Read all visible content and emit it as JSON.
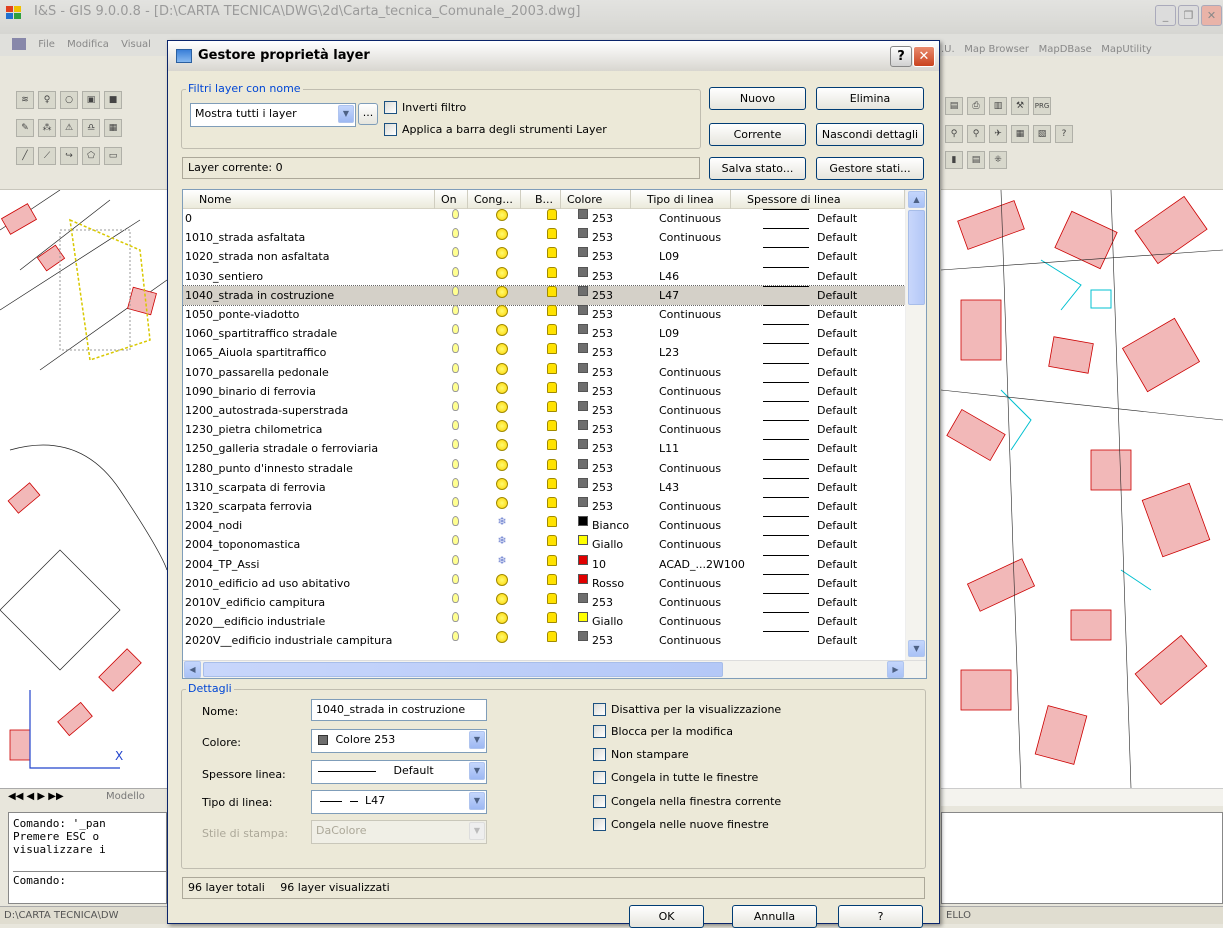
{
  "app": {
    "title": "I&S - GIS 9.0.0.8 - [D:\\CARTA TECNICA\\DWG\\2d\\Carta_tecnica_Comunale_2003.dwg]",
    "menu": [
      "File",
      "Modifica",
      "Visual"
    ],
    "menu_right": [
      ".U.",
      "Map Browser",
      "MapDBase",
      "MapUtility"
    ],
    "model_tab": "Modello",
    "cmd_lines": [
      "Comando: '_pan",
      "Premere ESC o",
      "visualizzare i",
      "",
      "Comando:"
    ],
    "status_path": "D:\\CARTA TECNICA\\DW",
    "status_right": "ELLO",
    "toolbar_icon_prg": "PRG"
  },
  "dialog": {
    "title": "Gestore proprietà layer",
    "help_btn": "?",
    "close_btn": "✕",
    "filter_group": "Filtri layer con nome",
    "filter_value": "Mostra tutti i layer",
    "filter_more": "...",
    "invert_filter": "Inverti filtro",
    "apply_toolbar": "Applica a barra degli strumenti Layer",
    "btn_new": "Nuovo",
    "btn_delete": "Elimina",
    "btn_current": "Corrente",
    "btn_hide_details": "Nascondi dettagli",
    "btn_save_state": "Salva stato...",
    "btn_state_manager": "Gestore stati...",
    "current_layer": "Layer corrente: 0",
    "columns": [
      "Nome",
      "On",
      "Cong...",
      "B...",
      "Colore",
      "Tipo di linea",
      "Spessore di linea"
    ],
    "layers": [
      {
        "name": "0",
        "color_name": "253",
        "color": "#6e6e6e",
        "ltype": "Continuous",
        "lw": "Default",
        "frozen": false
      },
      {
        "name": "1010_strada asfaltata",
        "color_name": "253",
        "color": "#6e6e6e",
        "ltype": "Continuous",
        "lw": "Default",
        "frozen": false
      },
      {
        "name": "1020_strada non asfaltata",
        "color_name": "253",
        "color": "#6e6e6e",
        "ltype": "L09",
        "lw": "Default",
        "frozen": false
      },
      {
        "name": "1030_sentiero",
        "color_name": "253",
        "color": "#6e6e6e",
        "ltype": "L46",
        "lw": "Default",
        "frozen": false
      },
      {
        "name": "1040_strada in costruzione",
        "color_name": "253",
        "color": "#6e6e6e",
        "ltype": "L47",
        "lw": "Default",
        "frozen": false,
        "selected": true
      },
      {
        "name": "1050_ponte-viadotto",
        "color_name": "253",
        "color": "#6e6e6e",
        "ltype": "Continuous",
        "lw": "Default",
        "frozen": false
      },
      {
        "name": "1060_spartitraffico stradale",
        "color_name": "253",
        "color": "#6e6e6e",
        "ltype": "L09",
        "lw": "Default",
        "frozen": false
      },
      {
        "name": "1065_Aiuola spartitraffico",
        "color_name": "253",
        "color": "#6e6e6e",
        "ltype": "L23",
        "lw": "Default",
        "frozen": false
      },
      {
        "name": "1070_passarella pedonale",
        "color_name": "253",
        "color": "#6e6e6e",
        "ltype": "Continuous",
        "lw": "Default",
        "frozen": false
      },
      {
        "name": "1090_binario di ferrovia",
        "color_name": "253",
        "color": "#6e6e6e",
        "ltype": "Continuous",
        "lw": "Default",
        "frozen": false
      },
      {
        "name": "1200_autostrada-superstrada",
        "color_name": "253",
        "color": "#6e6e6e",
        "ltype": "Continuous",
        "lw": "Default",
        "frozen": false
      },
      {
        "name": "1230_pietra chilometrica",
        "color_name": "253",
        "color": "#6e6e6e",
        "ltype": "Continuous",
        "lw": "Default",
        "frozen": false
      },
      {
        "name": "1250_galleria stradale o ferroviaria",
        "color_name": "253",
        "color": "#6e6e6e",
        "ltype": "L11",
        "lw": "Default",
        "frozen": false
      },
      {
        "name": "1280_punto d'innesto stradale",
        "color_name": "253",
        "color": "#6e6e6e",
        "ltype": "Continuous",
        "lw": "Default",
        "frozen": false
      },
      {
        "name": "1310_scarpata di ferrovia",
        "color_name": "253",
        "color": "#6e6e6e",
        "ltype": "L43",
        "lw": "Default",
        "frozen": false
      },
      {
        "name": "1320_scarpata ferrovia",
        "color_name": "253",
        "color": "#6e6e6e",
        "ltype": "Continuous",
        "lw": "Default",
        "frozen": false
      },
      {
        "name": "2004_nodi",
        "color_name": "Bianco",
        "color": "#000000",
        "ltype": "Continuous",
        "lw": "Default",
        "frozen": true
      },
      {
        "name": "2004_toponomastica",
        "color_name": "Giallo",
        "color": "#ffff00",
        "ltype": "Continuous",
        "lw": "Default",
        "frozen": true
      },
      {
        "name": "2004_TP_Assi",
        "color_name": "10",
        "color": "#e00000",
        "ltype": "ACAD_...2W100",
        "lw": "Default",
        "frozen": true
      },
      {
        "name": "2010_edificio ad uso abitativo",
        "color_name": "Rosso",
        "color": "#e00000",
        "ltype": "Continuous",
        "lw": "Default",
        "frozen": false
      },
      {
        "name": "2010V_edificio campitura",
        "color_name": "253",
        "color": "#6e6e6e",
        "ltype": "Continuous",
        "lw": "Default",
        "frozen": false
      },
      {
        "name": "2020__edificio industriale",
        "color_name": "Giallo",
        "color": "#ffff00",
        "ltype": "Continuous",
        "lw": "Default",
        "frozen": false
      },
      {
        "name": "2020V__edificio industriale campitura",
        "color_name": "253",
        "color": "#6e6e6e",
        "ltype": "Continuous",
        "lw": "Default",
        "frozen": false
      }
    ],
    "details_group": "Dettagli",
    "detail_name_label": "Nome:",
    "detail_name_value": "1040_strada in costruzione",
    "detail_color_label": "Colore:",
    "detail_color_value": "Colore 253",
    "detail_lw_label": "Spessore linea:",
    "detail_lw_value": "Default",
    "detail_ltype_label": "Tipo di linea:",
    "detail_ltype_value": "L47",
    "detail_plotstyle_label": "Stile di stampa:",
    "detail_plotstyle_value": "DaColore",
    "chk_disable": "Disattiva per la visualizzazione",
    "chk_lock": "Blocca per la modifica",
    "chk_noplot": "Non stampare",
    "chk_freeze_all": "Congela in tutte le finestre",
    "chk_freeze_current": "Congela nella finestra corrente",
    "chk_freeze_new": "Congela nelle nuove finestre",
    "total_layers": "96 layer totali",
    "shown_layers": "96 layer visualizzati",
    "btn_ok": "OK",
    "btn_cancel": "Annulla",
    "btn_help": "?"
  }
}
